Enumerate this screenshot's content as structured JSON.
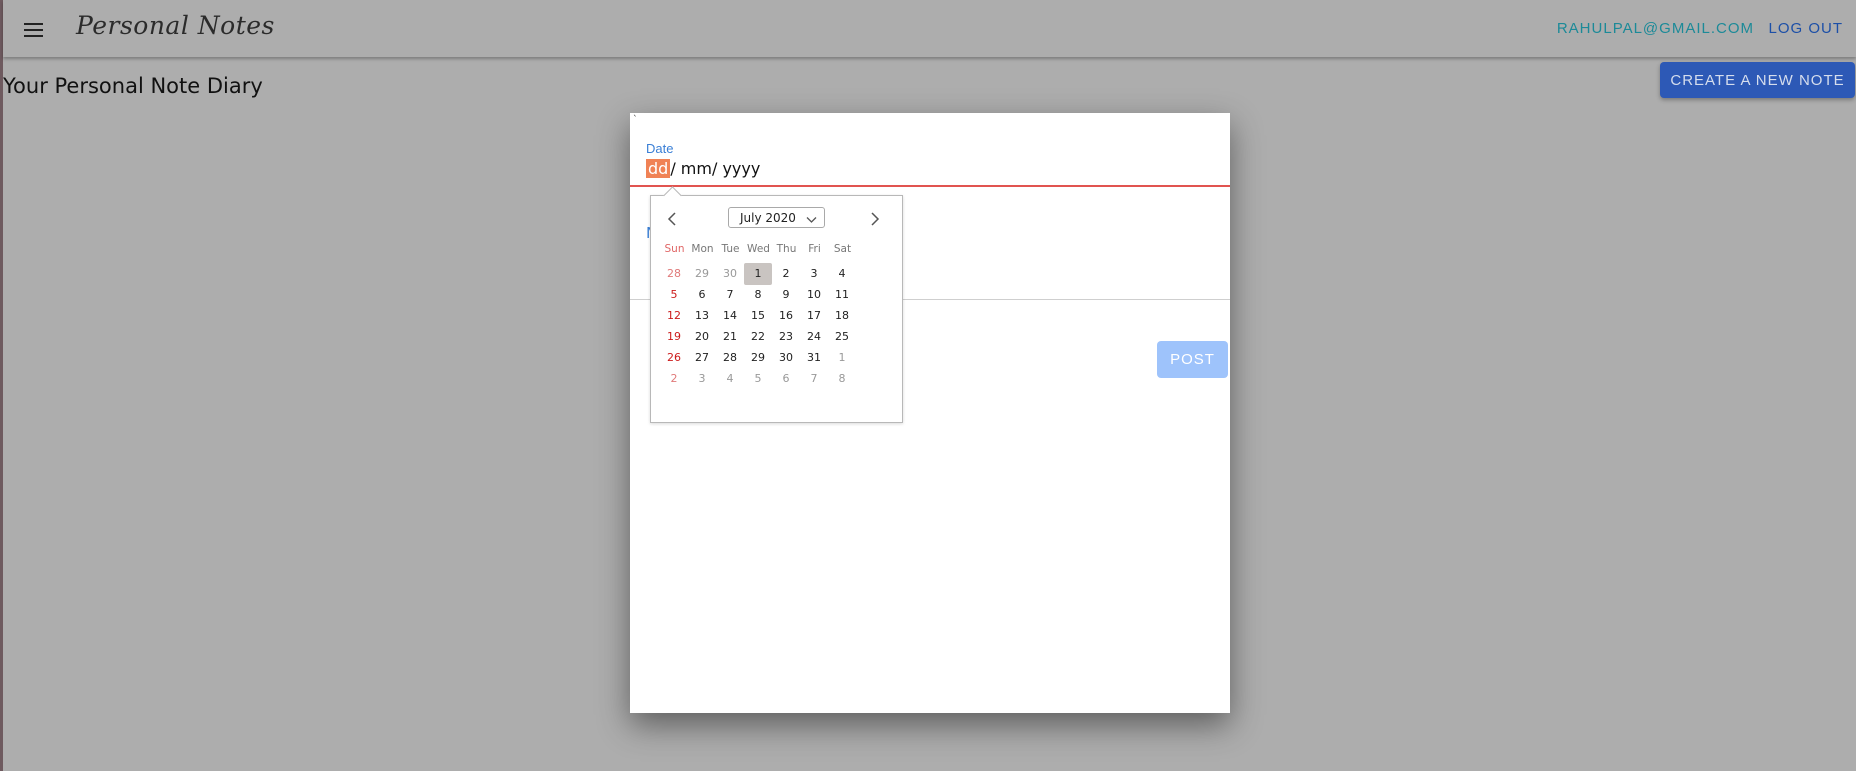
{
  "header": {
    "brand": "Personal Notes",
    "user_email": "RAHULPAL@GMAIL.COM",
    "logout_label": "LOG OUT"
  },
  "main": {
    "title": "Your Personal Note Diary",
    "create_button_label": "CREATE A NEW NOTE"
  },
  "dialog": {
    "tick": "`",
    "date_label": "Date",
    "date_segments": {
      "day": "dd",
      "month": "mm",
      "year": "yyyy",
      "separator": "/"
    },
    "second_field_label": "N",
    "post_label": "POST"
  },
  "datepicker": {
    "month_label": "July 2020",
    "weekdays": [
      "Sun",
      "Mon",
      "Tue",
      "Wed",
      "Thu",
      "Fri",
      "Sat"
    ],
    "weeks": [
      [
        {
          "d": "28",
          "o": true
        },
        {
          "d": "29",
          "o": true
        },
        {
          "d": "30",
          "o": true
        },
        {
          "d": "1",
          "sel": true
        },
        {
          "d": "2"
        },
        {
          "d": "3"
        },
        {
          "d": "4"
        }
      ],
      [
        {
          "d": "5"
        },
        {
          "d": "6"
        },
        {
          "d": "7"
        },
        {
          "d": "8"
        },
        {
          "d": "9"
        },
        {
          "d": "10"
        },
        {
          "d": "11"
        }
      ],
      [
        {
          "d": "12"
        },
        {
          "d": "13"
        },
        {
          "d": "14"
        },
        {
          "d": "15"
        },
        {
          "d": "16"
        },
        {
          "d": "17"
        },
        {
          "d": "18"
        }
      ],
      [
        {
          "d": "19"
        },
        {
          "d": "20"
        },
        {
          "d": "21"
        },
        {
          "d": "22"
        },
        {
          "d": "23"
        },
        {
          "d": "24"
        },
        {
          "d": "25"
        }
      ],
      [
        {
          "d": "26"
        },
        {
          "d": "27"
        },
        {
          "d": "28"
        },
        {
          "d": "29"
        },
        {
          "d": "30"
        },
        {
          "d": "31"
        },
        {
          "d": "1",
          "o": true
        }
      ],
      [
        {
          "d": "2",
          "o": true
        },
        {
          "d": "3",
          "o": true
        },
        {
          "d": "4",
          "o": true
        },
        {
          "d": "5",
          "o": true
        },
        {
          "d": "6",
          "o": true
        },
        {
          "d": "7",
          "o": true
        },
        {
          "d": "8",
          "o": true
        }
      ]
    ]
  },
  "colors": {
    "accent_blue": "#2d59b6",
    "email_teal": "#1c8a98",
    "error_red": "#e15450",
    "segment_highlight": "#f08255",
    "sunday_red": "#cc1b1b"
  },
  "icons": {
    "menu": "hamburger-menu-icon",
    "prev": "chevron-left-icon",
    "next": "chevron-right-icon",
    "dropdown": "chevron-down-icon"
  }
}
